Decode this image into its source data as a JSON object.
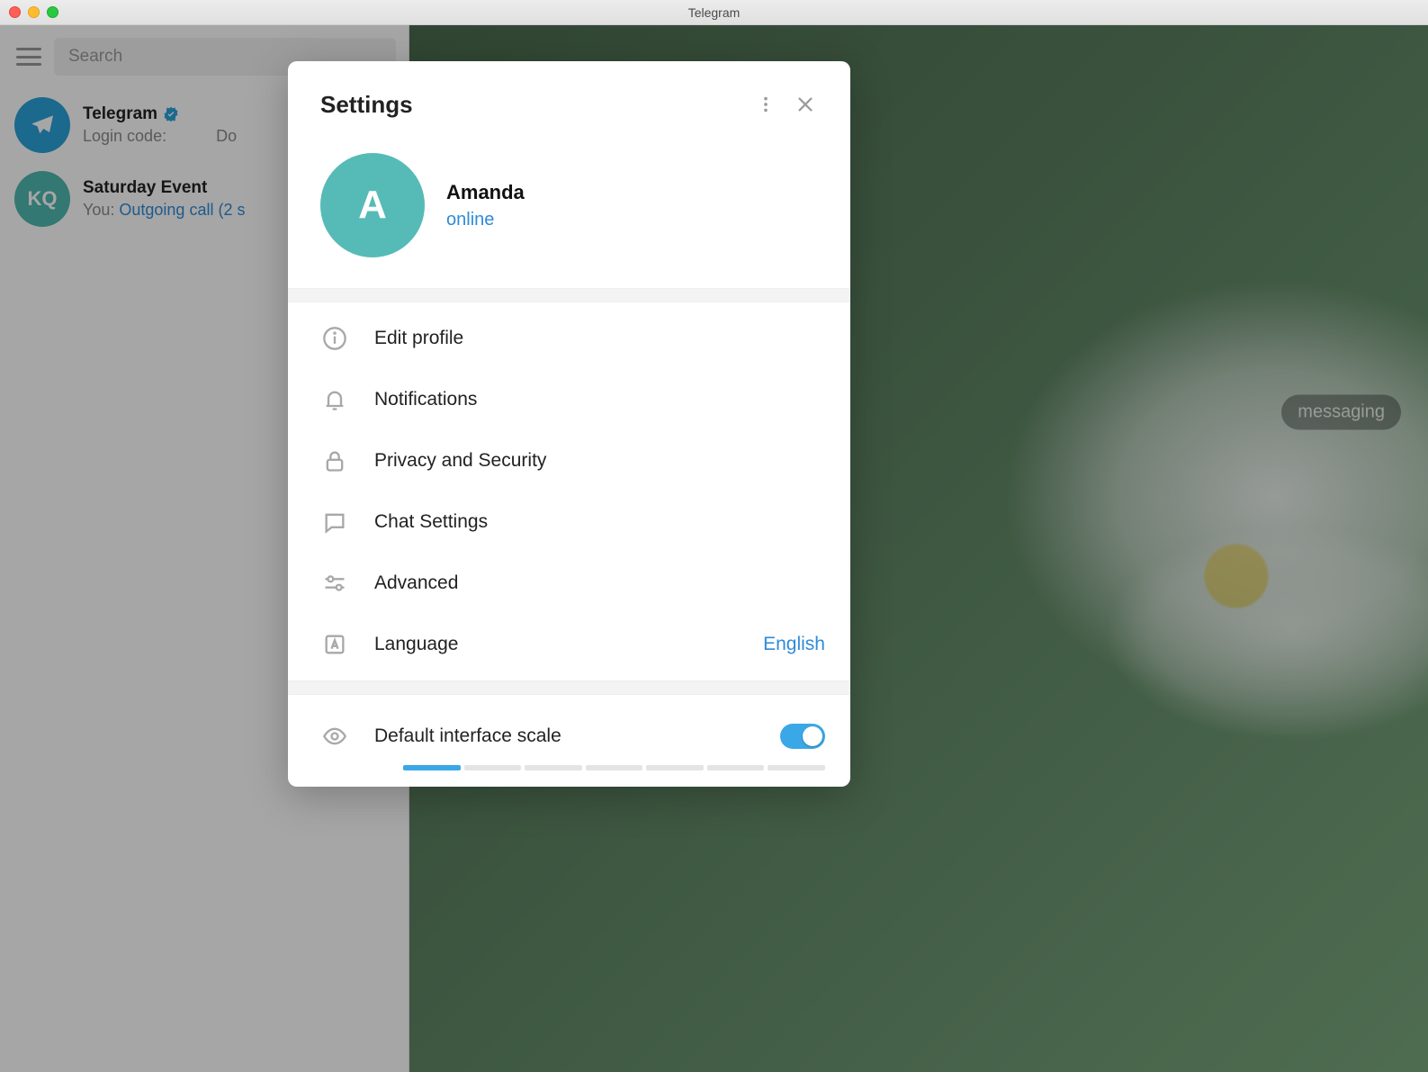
{
  "window": {
    "title": "Telegram"
  },
  "sidebar": {
    "search_placeholder": "Search",
    "chats": [
      {
        "title": "Telegram",
        "subtitle_prefix": "Login code:",
        "subtitle_suffix": "Do",
        "avatar_kind": "tg"
      },
      {
        "title": "Saturday Event",
        "subtitle_prefix": "You:",
        "subtitle_blue": " Outgoing call (2 s",
        "avatar_text": "KQ",
        "avatar_kind": "kq"
      }
    ]
  },
  "main": {
    "hint_bubble": "messaging"
  },
  "settings": {
    "title": "Settings",
    "profile": {
      "avatar_initial": "A",
      "name": "Amanda",
      "status": "online"
    },
    "items": [
      {
        "icon": "info",
        "label": "Edit profile"
      },
      {
        "icon": "bell",
        "label": "Notifications"
      },
      {
        "icon": "lock",
        "label": "Privacy and Security"
      },
      {
        "icon": "chat",
        "label": "Chat Settings"
      },
      {
        "icon": "sliders",
        "label": "Advanced"
      },
      {
        "icon": "lang",
        "label": "Language",
        "value": "English"
      }
    ],
    "scale": {
      "label": "Default interface scale",
      "enabled": true
    }
  }
}
